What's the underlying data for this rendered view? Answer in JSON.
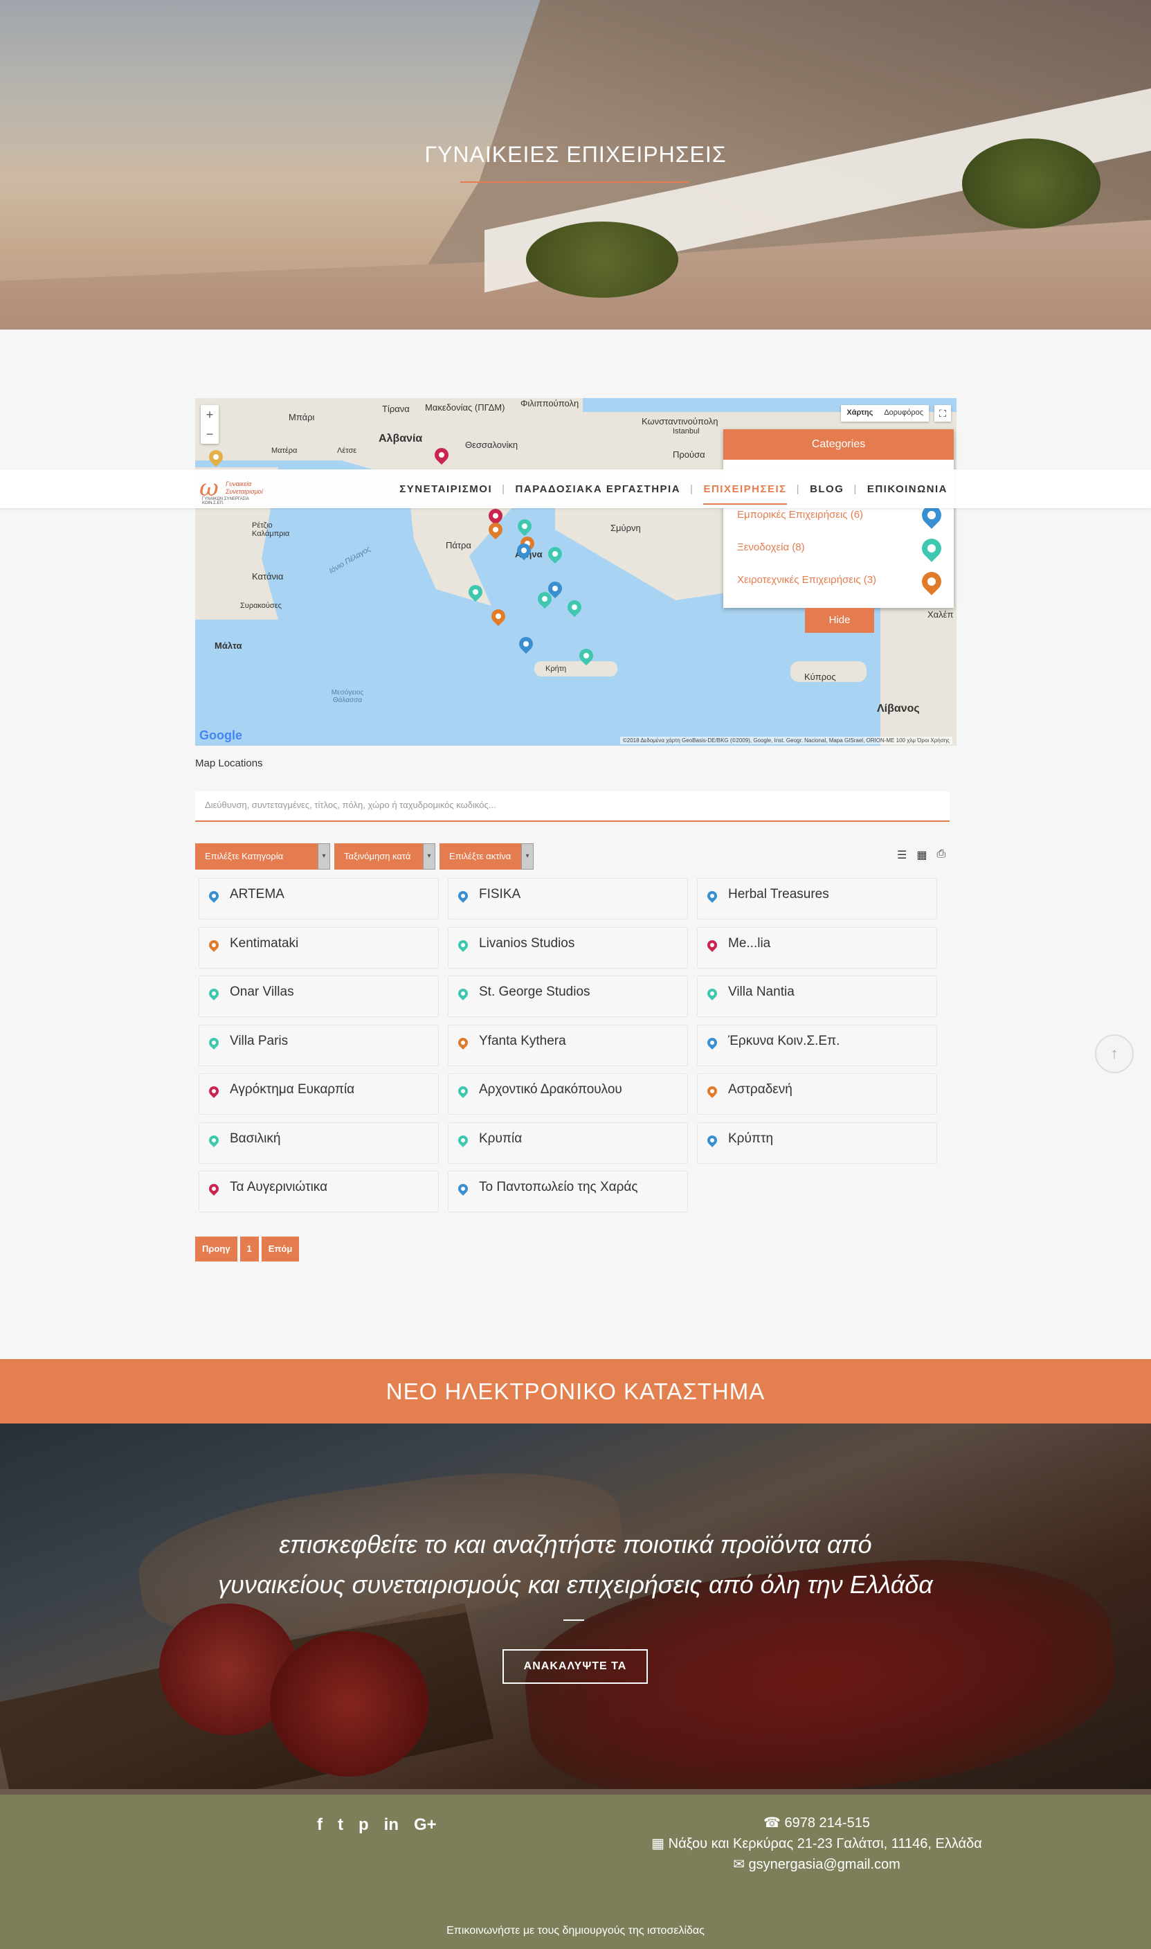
{
  "hero": {
    "title": "ΓΥΝΑΙΚΕΙΕΣ ΕΠΙΧΕΙΡΗΣΕΙΣ"
  },
  "nav": {
    "logo_line1": "Γυναικεία",
    "logo_line2": "Συνεταιρισμοί",
    "logo_line3": "ΓΥΝΑΙΚΩΝ ΣΥΝΕΡΓΑΣΙΑ ΚΟΙΝ.Σ.ΕΠ.",
    "items": [
      "ΣΥΝΕΤΑΙΡΙΣΜΟΙ",
      "ΠΑΡΑΔΟΣΙΑΚΑ ΕΡΓΑΣΤΗΡΙΑ",
      "ΕΠΙΧΕΙΡΗΣΕΙΣ",
      "BLOG",
      "ΕΠΙΚΟΙΝΩΝΙΑ"
    ],
    "active": "ΕΠΙΧΕΙΡΗΣΕΙΣ"
  },
  "map": {
    "zoom_in": "+",
    "zoom_out": "−",
    "type_map": "Χάρτης",
    "type_satellite": "Δορυφόρος",
    "google": "Google",
    "attribution": "©2018 Δεδομένα χάρτη GeoBasis-DE/BKG (©2009), Google, Inst. Geogr. Nacional, Mapa GISrael, ORION-ME   100 χλμ   Όροι Χρήσης",
    "labels": [
      "Τίρανα",
      "Αλβανία",
      "Μακεδονίας (ΠΓΔΜ)",
      "Θεσσαλονίκη",
      "Φιλιππούπολη",
      "Κωνσταντινούπολη",
      "Istanbul",
      "Προύσα",
      "Μπάρι",
      "Ματέρα",
      "Λέτσε",
      "Ρέτζιο Καλάμπρια",
      "Κατάνια",
      "Συρακούσες",
      "Μάλτα",
      "Πάτρα",
      "Αθήνα",
      "Σμύρνη",
      "Κρήτη",
      "Κύπρος",
      "Λίβανος",
      "Χαλέπ",
      "Ιόνιο Πέλαγος",
      "Μεσόγειος Θάλασσα"
    ],
    "categories_title": "Categories",
    "categories": [
      {
        "label": "Εμπορικές Επιχειρήσεις (6)",
        "color": "#3a8fd1"
      },
      {
        "label": "Ξενοδοχεία (8)",
        "color": "#3fc7b0"
      },
      {
        "label": "Χειροτεχνικές Επιχειρήσεις (3)",
        "color": "#e07b2a"
      }
    ],
    "hide_label": "Hide"
  },
  "map_locations_label": "Map Locations",
  "search": {
    "placeholder": "Διεύθυνση, συντεταγμένες, τίτλος, πόλη, χώρο ή ταχυδρομικός κωδικός..."
  },
  "filters": {
    "category": "Επιλέξτε Κατηγορία",
    "sort": "Ταξινόμηση κατά",
    "radius": "Επιλέξτε ακτίνα",
    "arrow": "▾"
  },
  "view_icons": [
    "list-icon",
    "grid-icon",
    "print-icon"
  ],
  "view_glyphs": [
    "☰",
    "▦",
    "⎙"
  ],
  "locations": [
    {
      "name": "ARTEMA",
      "color": "#3a8fd1"
    },
    {
      "name": "FISIKA",
      "color": "#3a8fd1"
    },
    {
      "name": "Herbal Treasures",
      "color": "#3a8fd1"
    },
    {
      "name": "Kentimataki",
      "color": "#e07b2a"
    },
    {
      "name": "Livanios Studios",
      "color": "#3fc7b0"
    },
    {
      "name": "Me...lia",
      "color": "#c8264f"
    },
    {
      "name": "Onar Villas",
      "color": "#3fc7b0"
    },
    {
      "name": "St. George Studios",
      "color": "#3fc7b0"
    },
    {
      "name": "Villa Nantia",
      "color": "#3fc7b0"
    },
    {
      "name": "Villa Paris",
      "color": "#3fc7b0"
    },
    {
      "name": "Yfanta Kythera",
      "color": "#e07b2a"
    },
    {
      "name": "Έρκυνα Κοιν.Σ.Επ.",
      "color": "#3a8fd1"
    },
    {
      "name": "Αγρόκτημα Ευκαρπία",
      "color": "#c8264f"
    },
    {
      "name": "Αρχοντικό Δρακόπουλου",
      "color": "#3fc7b0"
    },
    {
      "name": "Αστραδενή",
      "color": "#e07b2a"
    },
    {
      "name": "Βασιλική",
      "color": "#3fc7b0"
    },
    {
      "name": "Κρυπία",
      "color": "#3fc7b0"
    },
    {
      "name": "Κρύπτη",
      "color": "#3a8fd1"
    },
    {
      "name": "Τα Αυγερινιώτικα",
      "color": "#c8264f"
    },
    {
      "name": "Το Παντοπωλείο της Χαράς",
      "color": "#3a8fd1"
    }
  ],
  "pager": {
    "prev": "Προηγ",
    "page": "1",
    "next": "Επόμ"
  },
  "scroll_top": "↑",
  "banner": {
    "title": "ΝΕΟ ΗΛΕΚΤΡΟΝΙΚΟ ΚΑΤΑΣΤΗΜΑ"
  },
  "promo": {
    "line1": "επισκεφθείτε το και αναζητήστε ποιοτικά προϊόντα από",
    "line2": "γυναικείους συνεταιρισμούς και επιχειρήσεις από όλη την Ελλάδα",
    "button": "ΑΝΑΚΑΛΥΨΤΕ ΤΑ"
  },
  "footer": {
    "socials": [
      "f",
      "t",
      "p",
      "in",
      "G+"
    ],
    "phone": "☎ 6978 214-515",
    "address": "▦ Νάξου και Κερκύρας 21-23 Γαλάτσι, 11146, Ελλάδα",
    "email": "✉ gsynergasia@gmail.com",
    "credits": "Επικοινωνήστε με τους δημιουργούς της ιστοσελίδας"
  },
  "colors": {
    "accent": "#e47c50",
    "footer": "#7c7f5a"
  }
}
